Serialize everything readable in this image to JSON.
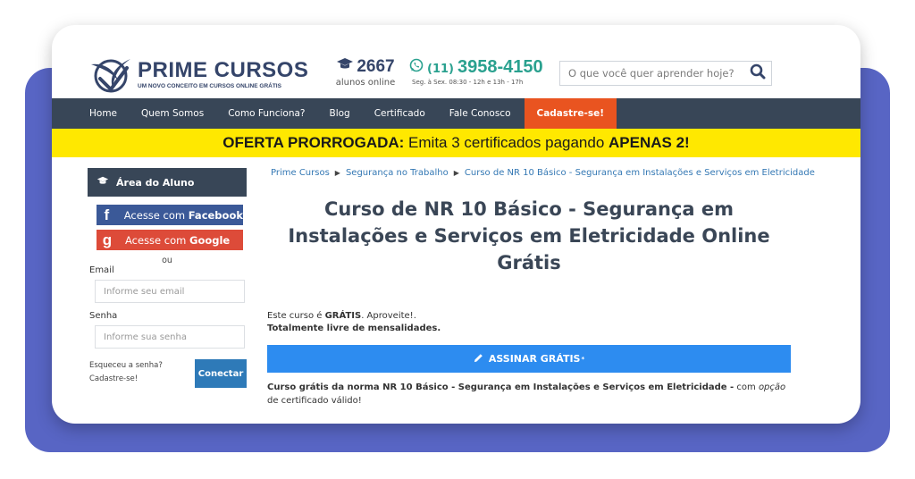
{
  "header": {
    "brand": "PRIME CURSOS",
    "tagline": "UM NOVO CONCEITO EM CURSOS ONLINE GRÁTIS",
    "students_count": "2667",
    "students_label": "alunos online",
    "phone_ddd": "(11)",
    "phone_number": "3958-4150",
    "phone_hours": "Seg. à Sex. 08:30 - 12h e 13h - 17h",
    "search_placeholder": "O que você quer aprender hoje?"
  },
  "nav": {
    "home": "Home",
    "about": "Quem Somos",
    "how": "Como Funciona?",
    "blog": "Blog",
    "certificate": "Certificado",
    "contact": "Fale Conosco",
    "signup": "Cadastre-se!"
  },
  "promo": {
    "lead": "OFERTA PRORROGADA:",
    "middle": " Emita 3 certificados pagando ",
    "tail": "APENAS 2!"
  },
  "sidebar": {
    "heading": "Área do Aluno",
    "facebook_pre": "Acesse com ",
    "facebook_bold": "Facebook",
    "google_pre": "Acesse com ",
    "google_bold": "Google",
    "or": "ou",
    "email_label": "Email",
    "email_placeholder": "Informe seu email",
    "password_label": "Senha",
    "password_placeholder": "Informe sua senha",
    "forgot": "Esqueceu a senha?",
    "register": "Cadastre-se!",
    "connect": "Conectar"
  },
  "breadcrumb": {
    "items": [
      "Prime Cursos",
      "Segurança no Trabalho",
      "Curso de NR 10 Básico - Segurança em Instalações e Serviços em Eletricidade"
    ]
  },
  "main": {
    "title": "Curso de NR 10 Básico - Segurança em Instalações e Serviços em Eletricidade Online Grátis",
    "intro_pre": "Este curso é ",
    "intro_bold": "GRÁTIS",
    "intro_post": ". Aproveite!.",
    "intro_line2": "Totalmente livre de mensalidades.",
    "cta": "ASSINAR GRÁTIS",
    "cta_sup": "*",
    "desc_bold": "Curso grátis da norma NR 10 Básico - Segurança em Instalações e Serviços em Eletricidade -",
    "desc_pre": " com ",
    "desc_em": "opção",
    "desc_post": " de certificado válido!"
  },
  "colors": {
    "accent_blue": "#2d8cf0",
    "nav_bg": "#384657",
    "promo_bg": "#ffe800",
    "signup_orange": "#e95420",
    "facebook": "#3b5998",
    "google": "#dd4b39",
    "phone_green": "#2aa18f",
    "back_card": "#5865c4"
  }
}
